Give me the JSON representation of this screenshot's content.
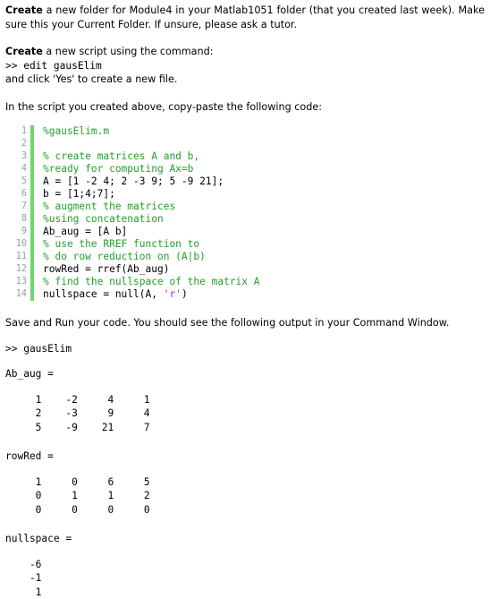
{
  "colors": {
    "comment_green": "#22a02a",
    "gutter_green": "#6fd66f",
    "string_purple": "#a020f0",
    "line_number_gray": "#9b9b9b",
    "text_black": "#000000",
    "background": "#ffffff"
  },
  "intro": {
    "para1_bold": "Create",
    "para1_rest": " a new folder for Module4 in your Matlab1051 folder (that you created last week). Make sure this your Current Folder. If unsure, please ask a tutor.",
    "para2_bold": "Create",
    "para2_rest": " a new script using the command:",
    "para2_command": ">> edit gausElim",
    "para2_after": "and click 'Yes' to create a new file.",
    "para3": "In the script you created above, copy-paste the following code:"
  },
  "code": {
    "lines": [
      {
        "num": "1",
        "segments": [
          {
            "text": "%gausElim.m",
            "cls": "c-comment"
          }
        ]
      },
      {
        "num": "2",
        "segments": [
          {
            "text": "",
            "cls": "c-plain"
          }
        ]
      },
      {
        "num": "3",
        "segments": [
          {
            "text": "% create matrices A and b,",
            "cls": "c-comment"
          }
        ]
      },
      {
        "num": "4",
        "segments": [
          {
            "text": "%ready for computing Ax=b",
            "cls": "c-comment"
          }
        ]
      },
      {
        "num": "5",
        "segments": [
          {
            "text": "A = [1 -2 4; 2 -3 9; 5 -9 21];",
            "cls": "c-plain"
          }
        ]
      },
      {
        "num": "6",
        "segments": [
          {
            "text": "b = [1;4;7];",
            "cls": "c-plain"
          }
        ]
      },
      {
        "num": "7",
        "segments": [
          {
            "text": "% augment the matrices",
            "cls": "c-comment"
          }
        ]
      },
      {
        "num": "8",
        "segments": [
          {
            "text": "%using concatenation",
            "cls": "c-comment"
          }
        ]
      },
      {
        "num": "9",
        "segments": [
          {
            "text": "Ab_aug = [A b]",
            "cls": "c-plain"
          }
        ]
      },
      {
        "num": "10",
        "segments": [
          {
            "text": "% use the RREF function to",
            "cls": "c-comment"
          }
        ]
      },
      {
        "num": "11",
        "segments": [
          {
            "text": "% do row reduction on (A|b)",
            "cls": "c-comment"
          }
        ]
      },
      {
        "num": "12",
        "segments": [
          {
            "text": "rowRed = rref(Ab_aug)",
            "cls": "c-plain"
          }
        ]
      },
      {
        "num": "13",
        "segments": [
          {
            "text": "% find the nullspace of the matrix A",
            "cls": "c-comment"
          }
        ]
      },
      {
        "num": "14",
        "segments": [
          {
            "text": "nullspace = null(A, ",
            "cls": "c-plain"
          },
          {
            "text": "'r'",
            "cls": "c-string"
          },
          {
            "text": ")",
            "cls": "c-plain"
          }
        ]
      }
    ]
  },
  "output": {
    "instruction": "Save and Run your code. You should see the following output in your Command Window.",
    "prompt": ">> gausElim",
    "blocks": [
      {
        "label": "Ab_aug =",
        "rows": [
          "     1    -2     4     1",
          "     2    -3     9     4",
          "     5    -9    21     7"
        ]
      },
      {
        "label": "rowRed =",
        "rows": [
          "     1     0     6     5",
          "     0     1     1     2",
          "     0     0     0     0"
        ]
      },
      {
        "label": "nullspace =",
        "rows": [
          "    -6",
          "    -1",
          "     1"
        ]
      }
    ]
  }
}
